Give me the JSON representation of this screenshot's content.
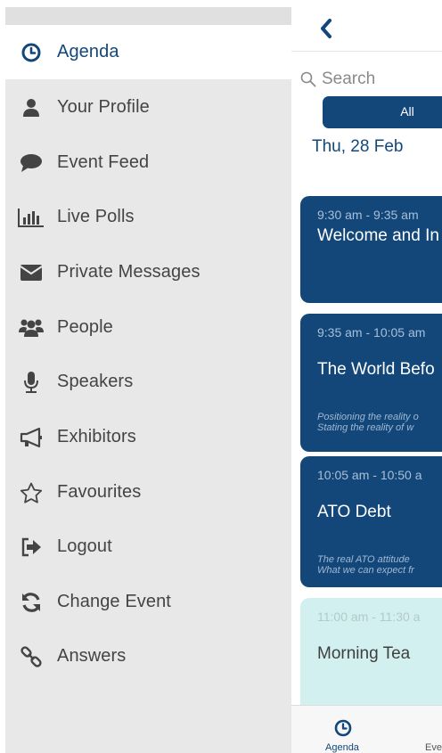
{
  "sidebar": {
    "items": [
      {
        "label": "Agenda",
        "icon": "clock-icon",
        "active": true
      },
      {
        "label": "Your Profile",
        "icon": "person-icon"
      },
      {
        "label": "Event Feed",
        "icon": "speech-bubble-icon"
      },
      {
        "label": "Live Polls",
        "icon": "bar-chart-icon"
      },
      {
        "label": "Private Messages",
        "icon": "envelope-icon"
      },
      {
        "label": "People",
        "icon": "group-icon"
      },
      {
        "label": "Speakers",
        "icon": "microphone-icon"
      },
      {
        "label": "Exhibitors",
        "icon": "megaphone-icon"
      },
      {
        "label": "Favourites",
        "icon": "star-outline-icon"
      },
      {
        "label": "Logout",
        "icon": "sign-out-icon"
      },
      {
        "label": "Change Event",
        "icon": "refresh-icon"
      },
      {
        "label": "Answers",
        "icon": "link-icon"
      }
    ]
  },
  "main": {
    "back_icon": "chevron-left-icon",
    "search": {
      "placeholder": "Search",
      "icon": "search-icon"
    },
    "filter": {
      "all_label": "All"
    },
    "date_header": "Thu, 28 Feb",
    "sessions": [
      {
        "time": "9:30 am - 9:35 am",
        "title": "Welcome and In",
        "desc": []
      },
      {
        "time": "9:35 am - 10:05 am",
        "title": "The World Befo",
        "desc": [
          "Positioning the reality o",
          "Stating the reality of w"
        ]
      },
      {
        "time": "10:05 am - 10:50 a",
        "title": "ATO Debt",
        "desc": [
          "The real ATO attitude",
          "What we can expect fr"
        ]
      },
      {
        "time": "11:00 am - 11:30 a",
        "title": "Morning Tea",
        "desc": []
      }
    ],
    "tabbar": {
      "tabs": [
        {
          "label": "Agenda",
          "icon": "clock-icon"
        },
        {
          "label": "Eve",
          "icon": ""
        }
      ]
    }
  },
  "colors": {
    "brand": "#13477a",
    "sidebar_bg": "#e8e8e8",
    "break_card": "#d3f0f0"
  }
}
